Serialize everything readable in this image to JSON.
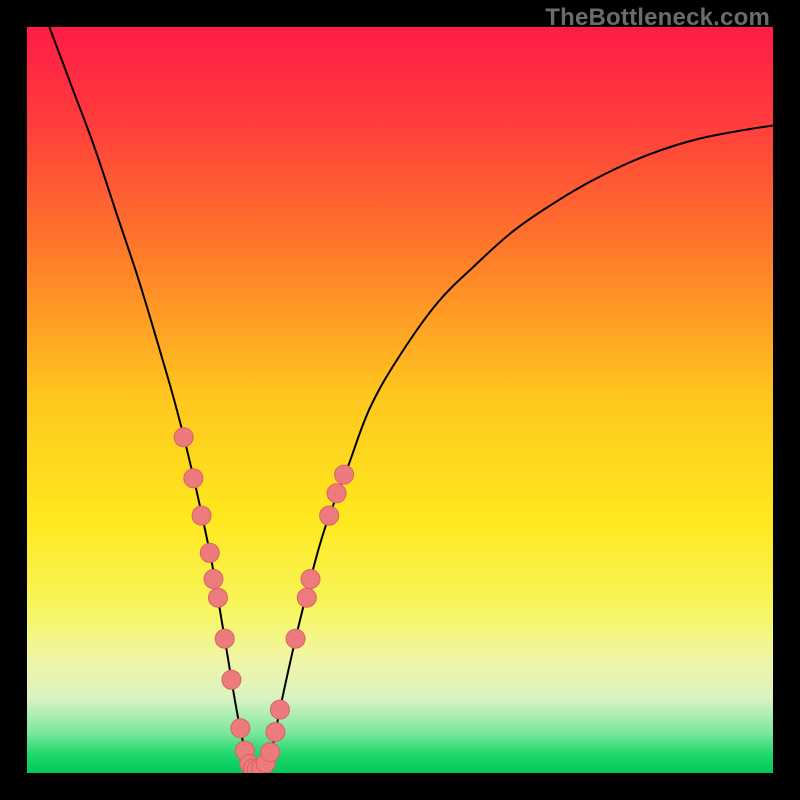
{
  "watermark": "TheBottleneck.com",
  "colors": {
    "gradient_stops": [
      {
        "offset": 0,
        "color": "#ff1c46"
      },
      {
        "offset": 0.12,
        "color": "#ff3a3d"
      },
      {
        "offset": 0.3,
        "color": "#ff7a2a"
      },
      {
        "offset": 0.5,
        "color": "#ffc81e"
      },
      {
        "offset": 0.66,
        "color": "#ffe81e"
      },
      {
        "offset": 0.78,
        "color": "#f7f65e"
      },
      {
        "offset": 0.85,
        "color": "#f0f5a7"
      },
      {
        "offset": 0.9,
        "color": "#d9f3c1"
      },
      {
        "offset": 0.945,
        "color": "#7fe7a0"
      },
      {
        "offset": 0.975,
        "color": "#1fd86a"
      },
      {
        "offset": 1.0,
        "color": "#04c95c"
      }
    ],
    "curve": "#000000",
    "dot_fill": "#ed7b7d",
    "dot_stroke": "#d96165"
  },
  "chart_data": {
    "type": "line",
    "title": "",
    "xlabel": "",
    "ylabel": "",
    "xlim": [
      0,
      100
    ],
    "ylim": [
      0,
      100
    ],
    "series": [
      {
        "name": "bottleneck-curve",
        "x": [
          3,
          6,
          9,
          12,
          15,
          18,
          20,
          22,
          24,
          25,
          26,
          27,
          28,
          29,
          30,
          31,
          32,
          33,
          34,
          36,
          38,
          40,
          43,
          46,
          50,
          55,
          60,
          65,
          70,
          75,
          80,
          85,
          90,
          95,
          100
        ],
        "y": [
          100,
          92,
          84,
          75,
          66,
          56,
          49,
          41,
          32,
          27,
          21,
          15,
          9,
          4,
          1,
          0.5,
          1,
          4,
          9,
          18,
          26,
          33,
          41,
          49,
          56,
          63,
          68,
          72.5,
          76,
          79,
          81.5,
          83.5,
          85,
          86,
          86.8
        ]
      }
    ],
    "scatter": {
      "name": "sample-points",
      "points": [
        {
          "x": 21.0,
          "y": 45.0
        },
        {
          "x": 22.3,
          "y": 39.5
        },
        {
          "x": 23.4,
          "y": 34.5
        },
        {
          "x": 24.5,
          "y": 29.5
        },
        {
          "x": 25.0,
          "y": 26.0
        },
        {
          "x": 25.6,
          "y": 23.5
        },
        {
          "x": 26.5,
          "y": 18.0
        },
        {
          "x": 27.4,
          "y": 12.5
        },
        {
          "x": 28.6,
          "y": 6.0
        },
        {
          "x": 29.2,
          "y": 3.0
        },
        {
          "x": 29.8,
          "y": 1.2
        },
        {
          "x": 30.3,
          "y": 0.6
        },
        {
          "x": 30.8,
          "y": 0.5
        },
        {
          "x": 31.4,
          "y": 0.6
        },
        {
          "x": 32.0,
          "y": 1.3
        },
        {
          "x": 32.6,
          "y": 2.8
        },
        {
          "x": 33.3,
          "y": 5.5
        },
        {
          "x": 33.9,
          "y": 8.5
        },
        {
          "x": 36.0,
          "y": 18.0
        },
        {
          "x": 37.5,
          "y": 23.5
        },
        {
          "x": 38.0,
          "y": 26.0
        },
        {
          "x": 40.5,
          "y": 34.5
        },
        {
          "x": 41.5,
          "y": 37.5
        },
        {
          "x": 42.5,
          "y": 40.0
        }
      ]
    }
  }
}
